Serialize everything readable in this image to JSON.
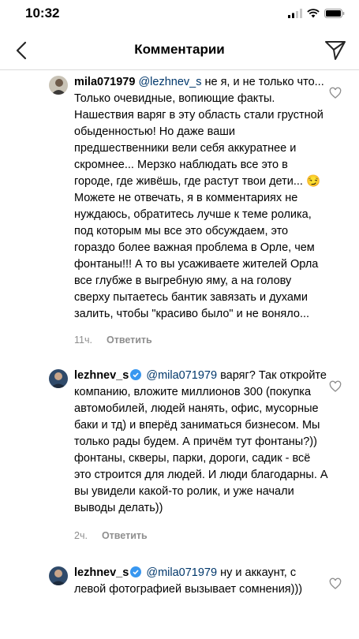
{
  "status": {
    "time": "10:32"
  },
  "header": {
    "title": "Комментарии"
  },
  "comments": [
    {
      "username": "mila071979",
      "mention": "@lezhnev_s",
      "text": " не я, и не только что... Только очевидные, вопиющие факты. Нашествия варяг в эту область стали грустной обыденностью! Но даже ваши предшественники вели себя аккуратнее и скромнее... Мерзко наблюдать все это в городе, где живёшь, где растут твои дети... 😏 Можете не отвечать, я в комментариях не нуждаюсь, обратитесь лучше к теме ролика, под которым мы все это обсуждаем, это гораздо более важная проблема в Орле, чем фонтаны!!! А то вы усаживаете жителей Орла все глубже в выгребную яму, а на голову сверху пытаетесь бантик завязать и духами залить, чтобы \"красиво было\" и не воняло...",
      "time": "11ч.",
      "reply": "Ответить"
    },
    {
      "username": "lezhnev_s",
      "mention": "@mila071979",
      "text": " варяг? Так откройте компанию, вложите миллионов 300 (покупка автомобилей, людей нанять, офис, мусорные баки и тд) и вперёд заниматься бизнесом. Мы только рады будем. А причём тут фонтаны?)) фонтаны, скверы, парки, дороги, садик - всё это строится для людей. И люди благодарны. А вы увидели какой-то ролик, и уже начали выводы делать))",
      "time": "2ч.",
      "reply": "Ответить"
    },
    {
      "username": "lezhnev_s",
      "mention": "@mila071979",
      "text": " ну и аккаунт, с левой фотографией вызывает сомнения)))"
    }
  ]
}
